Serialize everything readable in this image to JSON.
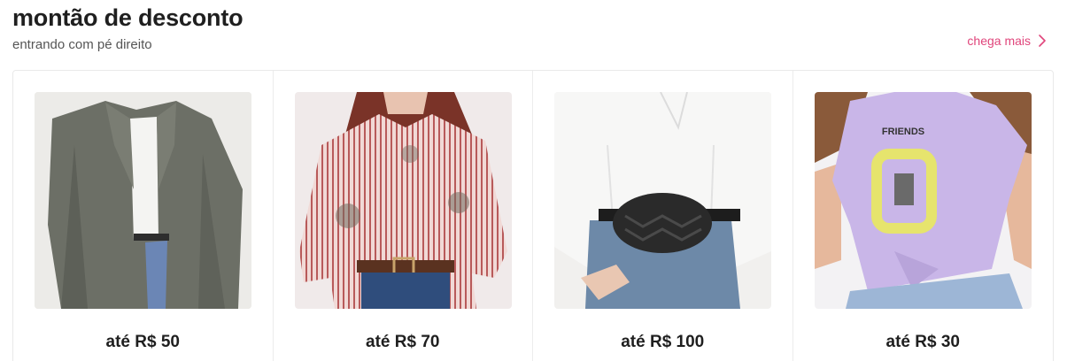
{
  "section": {
    "title": "montão de desconto",
    "subtitle": "entrando com pé direito",
    "more_label": "chega mais",
    "accent_color": "#e0457b"
  },
  "cards": [
    {
      "price_label": "até R$ 50",
      "image": "gray-blazer-photo"
    },
    {
      "price_label": "até R$ 70",
      "image": "striped-shirt-photo"
    },
    {
      "price_label": "até R$ 100",
      "image": "belt-bag-photo"
    },
    {
      "price_label": "até R$ 30",
      "image": "friends-tshirt-photo"
    }
  ]
}
